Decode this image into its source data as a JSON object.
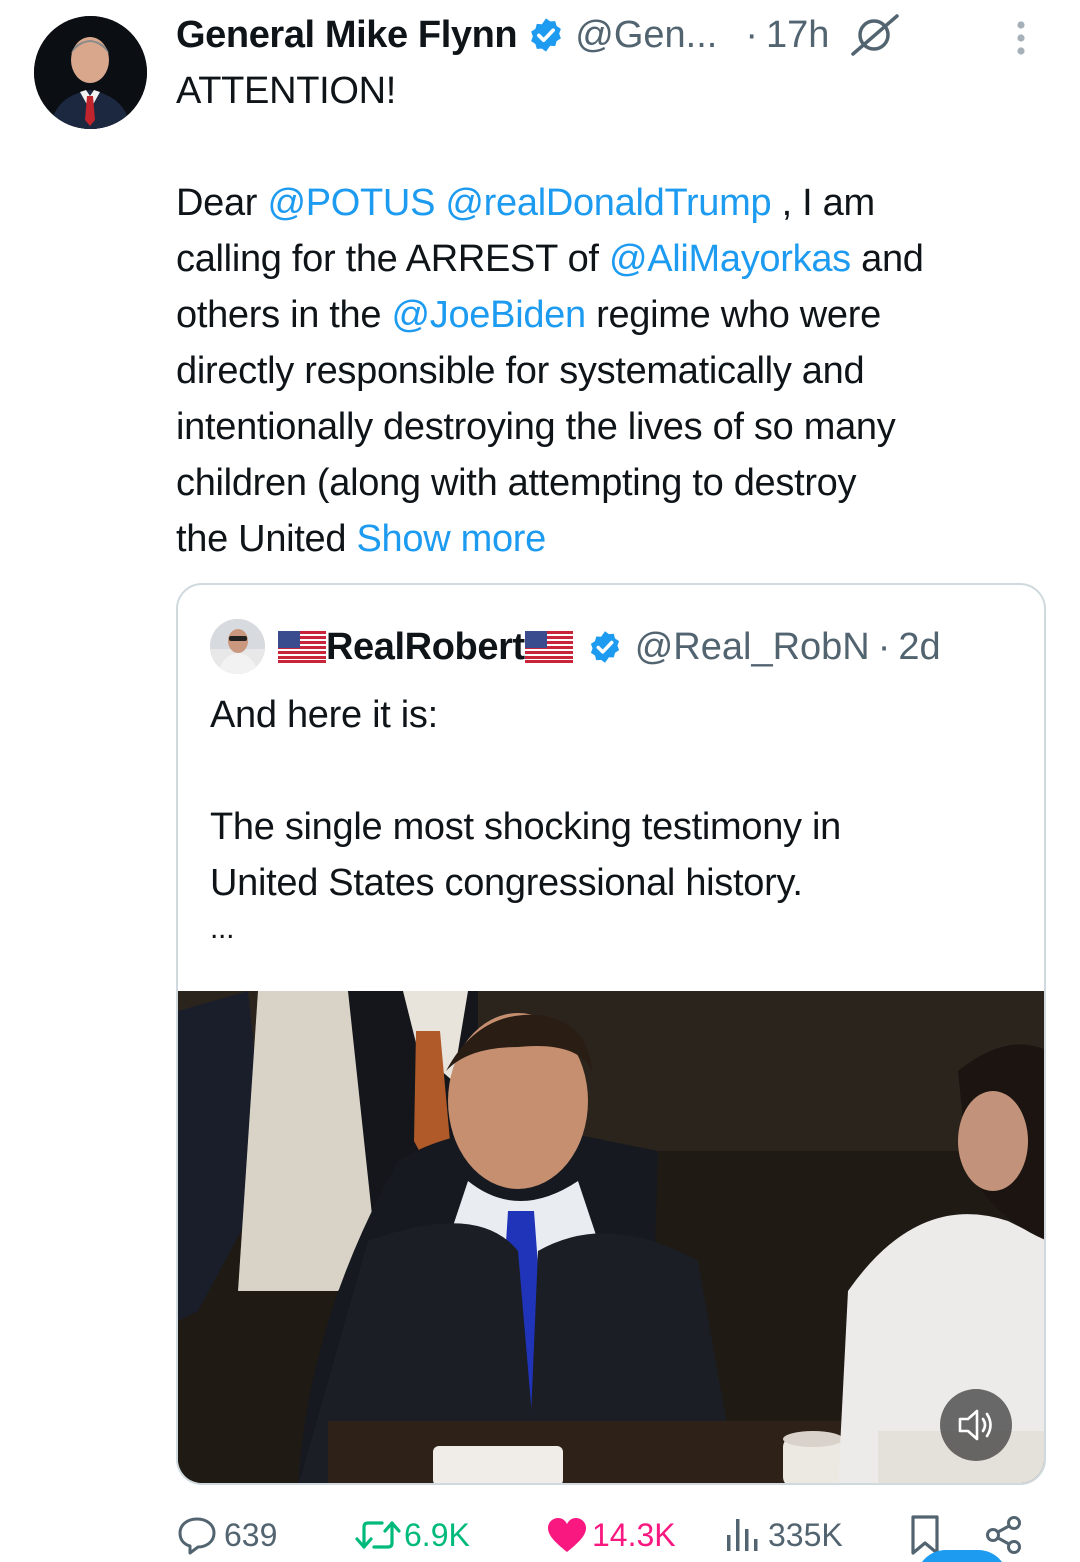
{
  "tweet": {
    "author_name": "General Mike Flynn",
    "author_handle": "@Gen...",
    "separator": "·",
    "time": "17h",
    "lines": [
      "ATTENTION!",
      "Dear ",
      "@POTUS",
      " ",
      "@realDonaldTrump",
      " , I am",
      "calling for the ARREST of ",
      "@AliMayorkas",
      " and",
      "others in the ",
      "@JoeBiden",
      " regime who were",
      "directly responsible for systematically and",
      "intentionally destroying the lives of so many",
      "children (along with attempting to destroy",
      "the United ",
      "Show more"
    ]
  },
  "quote": {
    "author_name": "RealRobert",
    "author_handle": "@Real_RobN",
    "separator": "·",
    "time": "2d",
    "line1": "And here it is:",
    "line2": "The single most shocking testimony in",
    "line3": "United States congressional history.",
    "ellipsis": "..."
  },
  "actions": {
    "replies": "639",
    "reposts": "6.9K",
    "likes": "14.3K",
    "views": "335K"
  },
  "colors": {
    "link": "#1d9bf0",
    "secondary_text": "#536471",
    "like": "#f91880",
    "border": "#cfd9de"
  }
}
